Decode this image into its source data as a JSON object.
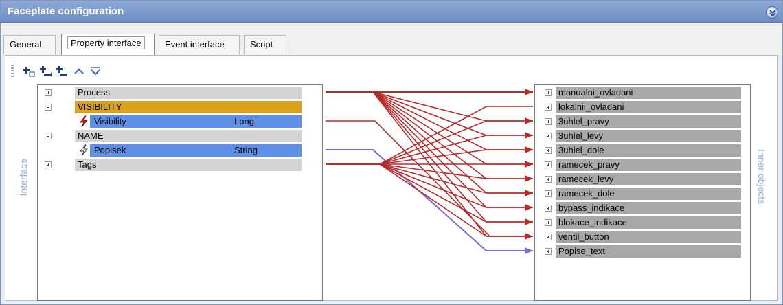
{
  "window": {
    "title": "Faceplate configuration"
  },
  "tabs": [
    {
      "label": "General"
    },
    {
      "label": "Property interface"
    },
    {
      "label": "Event interface"
    },
    {
      "label": "Script"
    }
  ],
  "side_labels": {
    "left": "Interface",
    "right": "Inner objects"
  },
  "interface_tree": {
    "process": "Process",
    "visibility_group": "VISIBILITY",
    "visibility_prop": {
      "name": "Visibility",
      "type": "Long"
    },
    "name_group": "NAME",
    "popisek_prop": {
      "name": "Popisek",
      "type": "String"
    },
    "tags": "Tags"
  },
  "inner_objects": [
    "manualni_ovladani",
    "lokalnii_ovladani",
    "3uhlel_pravy",
    "3uhlel_levy",
    "3uhlel_dole",
    "ramecek_pravy",
    "ramecek_levy",
    "ramecek_dole",
    "bypass_indikace",
    "blokace_indikace",
    "ventil_button",
    "Popise_text"
  ],
  "colors": {
    "link_red": "#b72a2a",
    "link_purple": "#7a68d6",
    "group_gold": "#daa21c",
    "prop_blue": "#5c8fe6",
    "row_gray": "#d4d4d4",
    "inner_gray": "#a8a8a8"
  },
  "icons": {
    "toolbar": [
      "add-group-icon",
      "add-property-icon",
      "add-child-icon",
      "move-up-icon",
      "move-down-icon"
    ],
    "collapse": "chevron-double-down-icon"
  }
}
